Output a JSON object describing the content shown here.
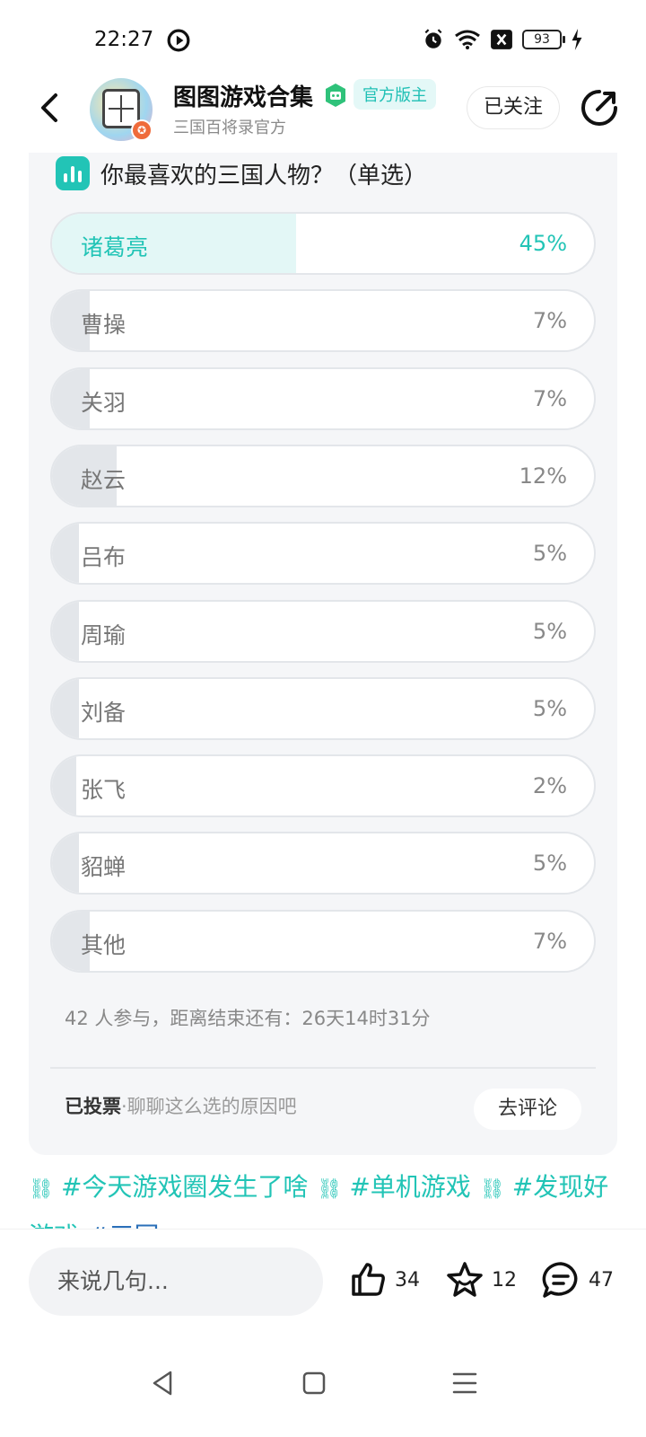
{
  "status": {
    "time": "22:27",
    "battery": "93"
  },
  "header": {
    "title": "图图游戏合集",
    "badge": "官方版主",
    "subtitle": "三国百将录官方",
    "follow": "已关注",
    "avatar_badge": "✪"
  },
  "poll": {
    "title": "你最喜欢的三国人物？（单选）",
    "options": [
      {
        "label": "诸葛亮",
        "pct_text": "45%",
        "pct": 45,
        "selected": true
      },
      {
        "label": "曹操",
        "pct_text": "7%",
        "pct": 7
      },
      {
        "label": "关羽",
        "pct_text": "7%",
        "pct": 7
      },
      {
        "label": "赵云",
        "pct_text": "12%",
        "pct": 12
      },
      {
        "label": "吕布",
        "pct_text": "5%",
        "pct": 5
      },
      {
        "label": "周瑜",
        "pct_text": "5%",
        "pct": 5
      },
      {
        "label": "刘备",
        "pct_text": "5%",
        "pct": 5
      },
      {
        "label": "张飞",
        "pct_text": "2%",
        "pct": 2
      },
      {
        "label": "貂蝉",
        "pct_text": "5%",
        "pct": 5
      },
      {
        "label": "其他",
        "pct_text": "7%",
        "pct": 7
      }
    ],
    "meta": "42 人参与，距离结束还有：26天14时31分",
    "voted": "已投票",
    "voted_hint": "·聊聊这么选的原因吧",
    "comment_btn": "去评论"
  },
  "tags": [
    {
      "text": "#今天游戏圈发生了啥",
      "link": true
    },
    {
      "text": "#单机游戏",
      "link": true
    },
    {
      "text": "#发现好游戏",
      "link": true
    },
    {
      "text": "#三国",
      "link": false
    }
  ],
  "bottom": {
    "input_placeholder": "来说几句...",
    "likes": "34",
    "favorites": "12",
    "comments": "47"
  },
  "colors": {
    "accent": "#22c4b6",
    "tag_blue": "#2a6fb8"
  }
}
